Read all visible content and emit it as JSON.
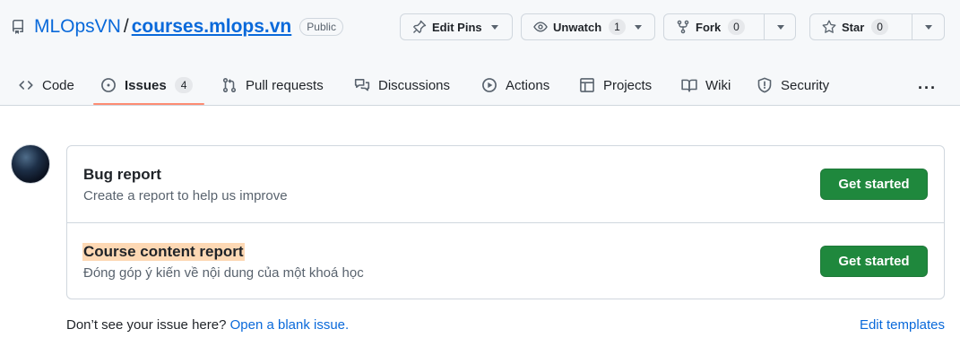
{
  "repo": {
    "owner": "MLOpsVN",
    "separator": "/",
    "name": "courses.mlops.vn",
    "visibility": "Public",
    "icon": "repo-icon"
  },
  "actions": {
    "edit_pins": {
      "label": "Edit Pins",
      "icon": "pin-icon"
    },
    "unwatch": {
      "label": "Unwatch",
      "count": "1",
      "icon": "eye-icon"
    },
    "fork": {
      "label": "Fork",
      "count": "0",
      "icon": "fork-icon"
    },
    "star": {
      "label": "Star",
      "count": "0",
      "icon": "star-icon"
    }
  },
  "tabs": [
    {
      "label": "Code",
      "icon": "code-icon"
    },
    {
      "label": "Issues",
      "count": "4",
      "icon": "issue-opened-icon",
      "selected": true
    },
    {
      "label": "Pull requests",
      "icon": "git-pull-request-icon"
    },
    {
      "label": "Discussions",
      "icon": "comment-discussion-icon"
    },
    {
      "label": "Actions",
      "icon": "play-icon"
    },
    {
      "label": "Projects",
      "icon": "table-icon"
    },
    {
      "label": "Wiki",
      "icon": "book-icon"
    },
    {
      "label": "Security",
      "icon": "shield-icon"
    }
  ],
  "more_label": "···",
  "templates": [
    {
      "title": "Bug report",
      "description": "Create a report to help us improve",
      "button": "Get started",
      "highlighted": false
    },
    {
      "title": "Course content report",
      "description": "Đóng góp ý kiến về nội dung của một khoá học",
      "button": "Get started",
      "highlighted": true
    }
  ],
  "footer": {
    "prompt": "Don’t see your issue here?",
    "link": "Open a blank issue.",
    "edit_templates": "Edit templates"
  },
  "colors": {
    "accent": "#0969da",
    "primary_button": "#1f883d",
    "tab_underline": "#fd8c73",
    "highlight": "#fdd8b4"
  }
}
